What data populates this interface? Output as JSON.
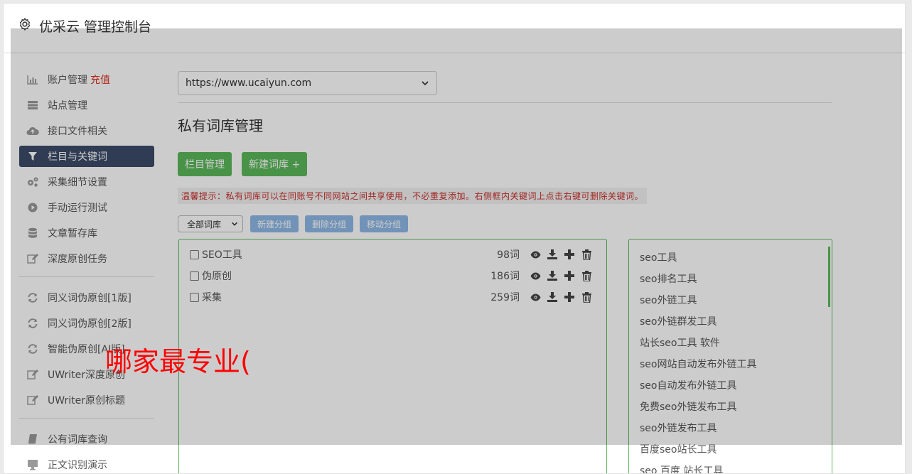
{
  "header": {
    "title": "优采云 管理控制台"
  },
  "sidebar": {
    "group1": [
      {
        "label": "账户管理",
        "badge": "充值",
        "icon": "bar-chart-icon"
      },
      {
        "label": "站点管理",
        "icon": "server-icon"
      },
      {
        "label": "接口文件相关",
        "icon": "cloud-upload-icon"
      },
      {
        "label": "栏目与关键词",
        "icon": "filter-icon",
        "active": true
      },
      {
        "label": "采集细节设置",
        "icon": "gears-icon"
      },
      {
        "label": "手动运行测试",
        "icon": "play-icon"
      },
      {
        "label": "文章暂存库",
        "icon": "database-icon"
      },
      {
        "label": "深度原创任务",
        "icon": "edit-icon"
      }
    ],
    "group2": [
      {
        "label": "同义词伪原创[1版]",
        "icon": "refresh-icon"
      },
      {
        "label": "同义词伪原创[2版]",
        "icon": "refresh-icon"
      },
      {
        "label": "智能伪原创[AI版]",
        "icon": "refresh-icon"
      },
      {
        "label": "UWriter深度原创",
        "icon": "edit-icon"
      },
      {
        "label": "UWriter原创标题",
        "icon": "edit-icon"
      }
    ],
    "group3": [
      {
        "label": "公有词库查询",
        "icon": "book-icon"
      },
      {
        "label": "正文识别演示",
        "icon": "monitor-icon"
      }
    ]
  },
  "main": {
    "site_select": "https://www.ucaiyun.com",
    "page_title": "私有词库管理",
    "btn_columns": "栏目管理",
    "btn_new_lib": "新建词库 +",
    "tip": "温馨提示：私有词库可以在同账号不同网站之间共享使用，不必重复添加。右侧框内关键词上点击右键可删除关键词。",
    "lib_select": "全部词库",
    "btn_new_group": "新建分组",
    "btn_del_group": "删除分组",
    "btn_move_group": "移动分组",
    "groups": [
      {
        "name": "SEO工具",
        "count": "98词"
      },
      {
        "name": "伪原创",
        "count": "186词"
      },
      {
        "name": "采集",
        "count": "259词"
      }
    ],
    "keywords": [
      "seo工具",
      "seo排名工具",
      "seo外链工具",
      "seo外链群发工具",
      "站长seo工具 软件",
      "seo网站自动发布外链工具",
      "seo自动发布外链工具",
      "免费seo外链发布工具",
      "seo外链发布工具",
      "百度seo站长工具",
      "seo 百度 站长工具"
    ]
  },
  "overlay_text": "哪家最专业(",
  "colors": {
    "active_nav": "#3b4b68",
    "green": "#5cb85c",
    "blue": "#8fb8e6",
    "tip_red": "#c9302c"
  }
}
